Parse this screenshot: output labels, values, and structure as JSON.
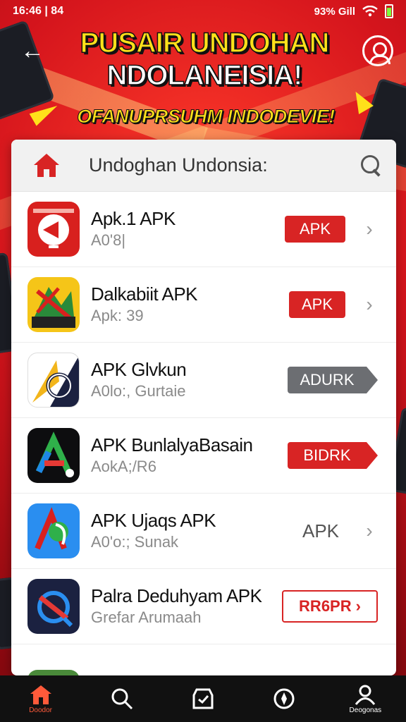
{
  "status_bar": {
    "time": "16:46 | 84",
    "right": "93% Gill"
  },
  "banner": {
    "title_line1": "PUSAIR UNDOHAN",
    "title_line2": "NDOLANEISIA!",
    "subtitle": "OFANUPRSUHM INDODEVIE!"
  },
  "search": {
    "text": "Undoghan Undonsia:"
  },
  "apps": [
    {
      "name": "Apk.1 APK",
      "meta": "A0'8|",
      "button": "APK",
      "button_style": "red",
      "icon": "red-play-icon"
    },
    {
      "name": "Dalkabiit APK",
      "meta": "Apk: 39",
      "button": "APK",
      "button_style": "red",
      "icon": "yellow-tool-icon"
    },
    {
      "name": "APK Glvkun",
      "meta": "A0lo:, Gurtaie",
      "button": "ADURK",
      "button_style": "grey-arrow",
      "icon": "compass-icon"
    },
    {
      "name": "APK BunlalyaBasain",
      "meta": "AokA;/R6",
      "button": "BIDRK",
      "button_style": "red-arrow",
      "icon": "triangle-logo-icon"
    },
    {
      "name": "APK Ujaqs APK",
      "meta": "A0'o:; Sunak",
      "button": "APK",
      "button_style": "text",
      "icon": "blue-app-icon"
    },
    {
      "name": "Palra Deduhyam APK",
      "meta": "Grefar Arumaah",
      "button": "RR6PR",
      "button_style": "outline-red",
      "icon": "navy-globe-icon"
    }
  ],
  "bottom_nav": [
    {
      "label": "Doodor",
      "icon": "home-icon",
      "active": true
    },
    {
      "label": "",
      "icon": "search-icon",
      "active": false
    },
    {
      "label": "",
      "icon": "app-store-icon",
      "active": false
    },
    {
      "label": "",
      "icon": "compass-icon",
      "active": false
    },
    {
      "label": "Deogonas",
      "icon": "profile-icon",
      "active": false
    }
  ],
  "colors": {
    "accent": "#d82424",
    "grey_button": "#6c6e72",
    "nav_bg": "#111111"
  }
}
